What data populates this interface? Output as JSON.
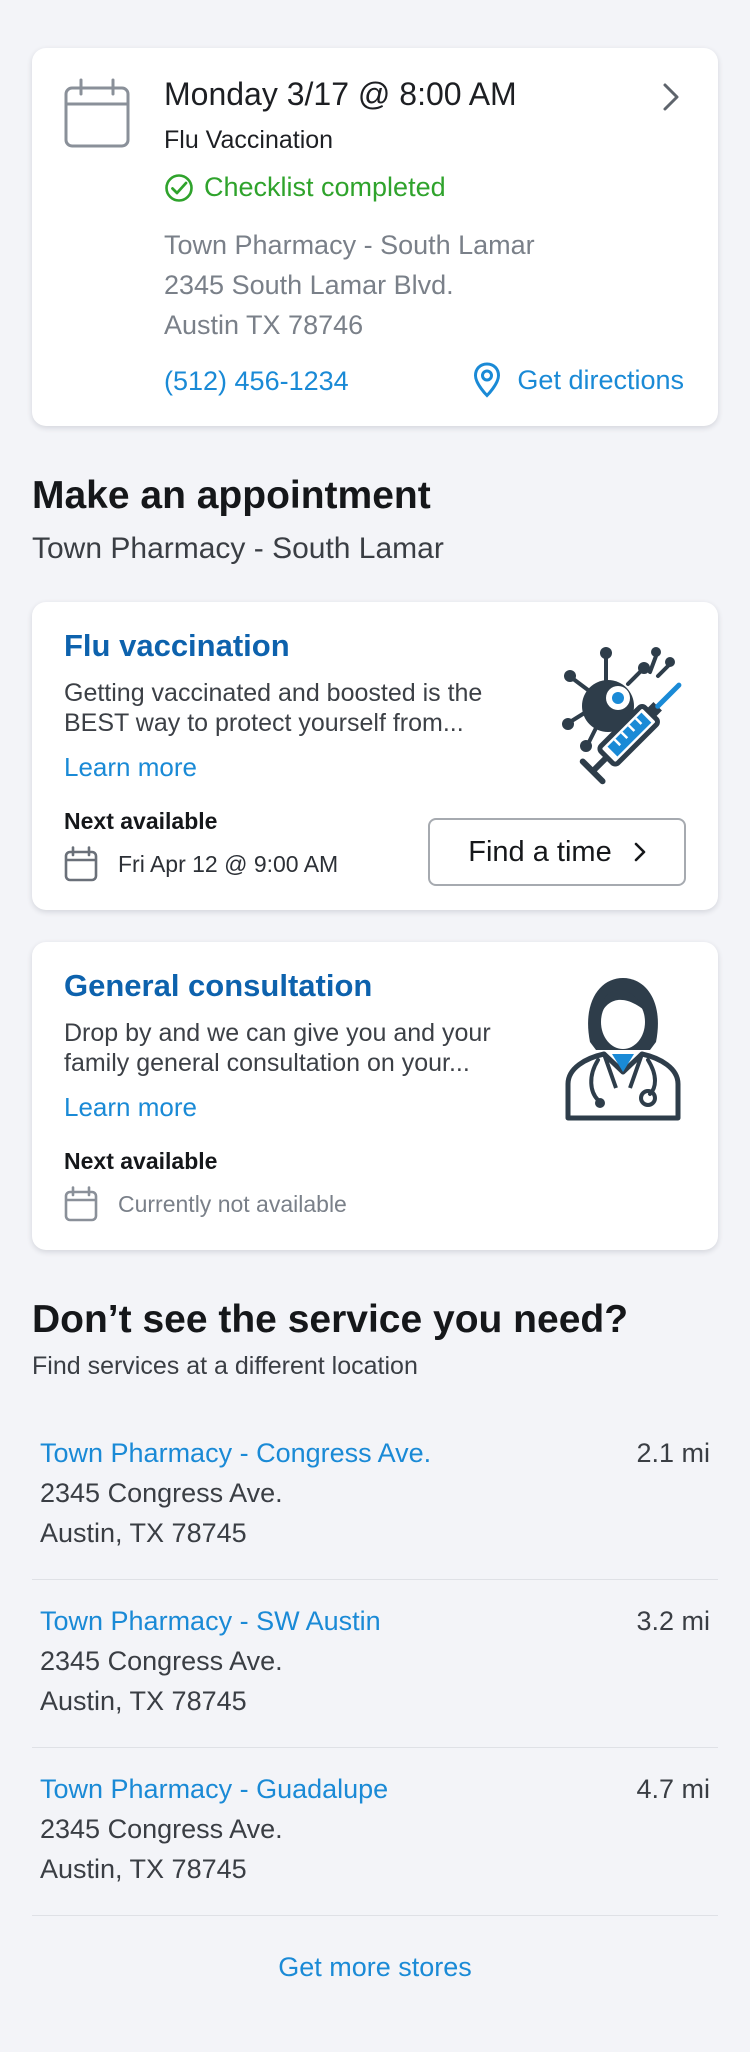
{
  "appointment": {
    "datetime": "Monday 3/17 @ 8:00 AM",
    "service": "Flu Vaccination",
    "checklist_status": "Checklist completed",
    "address_lines": [
      "Town Pharmacy - South Lamar",
      "2345 South Lamar Blvd.",
      "Austin TX 78746"
    ],
    "phone": "(512) 456-1234",
    "directions_label": "Get directions",
    "icons": {
      "calendar": "calendar-icon",
      "chevron": "chevron-right-icon",
      "check": "check-circle-icon",
      "pin": "location-pin-icon"
    }
  },
  "make_appointment": {
    "title": "Make an appointment",
    "location": "Town Pharmacy - South Lamar"
  },
  "services": [
    {
      "title": "Flu vaccination",
      "description": "Getting vaccinated and boosted is the BEST way to protect yourself from...",
      "learn_more": "Learn more",
      "next_label": "Next available",
      "next_value": "Fri Apr 12 @ 9:00 AM",
      "button_label": "Find a time",
      "illustration": "vaccine-syringe-illustration"
    },
    {
      "title": "General consultation",
      "description": "Drop by and we can give you and your family general consultation on your...",
      "learn_more": "Learn more",
      "next_label": "Next available",
      "next_value": "Currently not available",
      "illustration": "doctor-illustration"
    }
  ],
  "other_locations": {
    "title": "Don’t see the service you need?",
    "subtitle": "Find services at a different location",
    "stores": [
      {
        "name": "Town Pharmacy - Congress Ave.",
        "distance": "2.1 mi",
        "address1": "2345 Congress Ave.",
        "address2": "Austin, TX 78745"
      },
      {
        "name": "Town Pharmacy - SW Austin",
        "distance": "3.2 mi",
        "address1": "2345 Congress Ave.",
        "address2": "Austin, TX 78745"
      },
      {
        "name": "Town Pharmacy - Guadalupe",
        "distance": "4.7 mi",
        "address1": "2345 Congress Ave.",
        "address2": "Austin, TX 78745"
      }
    ],
    "more_label": "Get more stores"
  },
  "colors": {
    "link": "#1a8ad6",
    "service_title": "#0d62ad",
    "success": "#2fa32c",
    "muted": "#7a8089",
    "background": "#f3f4f8",
    "illustration_dark": "#2e3d4a"
  }
}
